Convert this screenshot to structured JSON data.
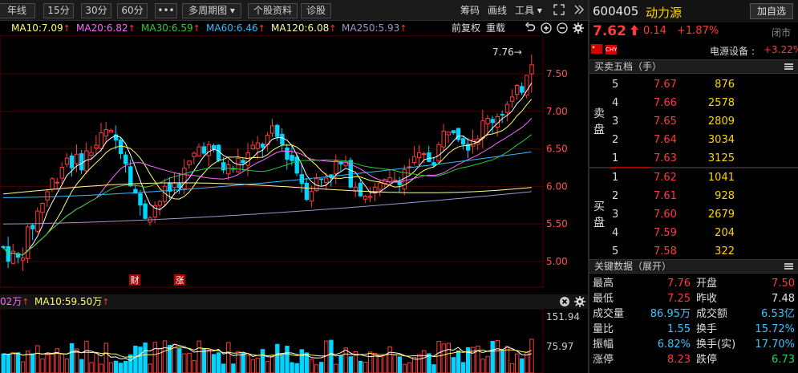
{
  "toolbar": {
    "period_buttons": [
      "年线",
      "15分",
      "30分",
      "60分"
    ],
    "more_label": "•••",
    "multi_period_label": "多周期图 ▾",
    "stock_info_label": "个股资料",
    "diagnosis_label": "诊股",
    "chip_label": "筹码",
    "draw_label": "画线",
    "tools_label": "工具 ▾",
    "expand_icon": "expand-icon",
    "collapse_icon": "double-chevron-right-icon"
  },
  "ma_legend": [
    {
      "label": "MA10:7.09",
      "color": "#ffff66"
    },
    {
      "label": "MA20:6.82",
      "color": "#ff66ff"
    },
    {
      "label": "MA30:6.59",
      "color": "#33cc33"
    },
    {
      "label": "MA60:6.46",
      "color": "#33bbff"
    },
    {
      "label": "MA120:6.08",
      "color": "#ffff99"
    },
    {
      "label": "MA250:5.93",
      "color": "#9999cc"
    }
  ],
  "adjust": {
    "forward_label": "前复权",
    "reload_label": "重载"
  },
  "price_axis": [
    "7.50",
    "7.00",
    "6.50",
    "6.00",
    "5.50",
    "5.00"
  ],
  "high_marker": "7.76→",
  "chart_markers": [
    "财",
    "涨"
  ],
  "volume": {
    "label_left": "02万",
    "ma_label": "MA10:59.50万",
    "axis": [
      "151.94",
      "75.97"
    ]
  },
  "stock": {
    "code": "600405",
    "name": "动力源",
    "add_label": "加自选",
    "price": "7.62",
    "change": "0.14",
    "change_pct": "+1.87%",
    "status": "闭市",
    "sector_label": "电源设备 :",
    "sector_pct": "+3.22%",
    "flag_text": "CHY"
  },
  "order_book": {
    "title": "买卖五档（手）",
    "sell_label": [
      "卖",
      "盘"
    ],
    "buy_label": [
      "买",
      "盘"
    ],
    "asks": [
      {
        "level": "5",
        "price": "7.67",
        "vol": "876"
      },
      {
        "level": "4",
        "price": "7.66",
        "vol": "2578"
      },
      {
        "level": "3",
        "price": "7.65",
        "vol": "2809"
      },
      {
        "level": "2",
        "price": "7.64",
        "vol": "3034"
      },
      {
        "level": "1",
        "price": "7.63",
        "vol": "3125"
      }
    ],
    "bids": [
      {
        "level": "1",
        "price": "7.62",
        "vol": "1041"
      },
      {
        "level": "2",
        "price": "7.61",
        "vol": "928"
      },
      {
        "level": "3",
        "price": "7.60",
        "vol": "2679"
      },
      {
        "level": "4",
        "price": "7.59",
        "vol": "204"
      },
      {
        "level": "5",
        "price": "7.58",
        "vol": "322"
      }
    ]
  },
  "key_data": {
    "title": "关键数据（展开）",
    "rows": [
      {
        "l1": "最高",
        "v1": "7.76",
        "c1": "red",
        "l2": "开盘",
        "v2": "7.50",
        "c2": "red"
      },
      {
        "l1": "最低",
        "v1": "7.25",
        "c1": "red",
        "l2": "昨收",
        "v2": "7.48",
        "c2": "white"
      },
      {
        "l1": "成交量",
        "v1": "86.95万",
        "c1": "cyan",
        "l2": "成交额",
        "v2": "6.53亿",
        "c2": "cyan"
      },
      {
        "l1": "量比",
        "v1": "1.55",
        "c1": "cyan",
        "l2": "换手",
        "v2": "15.72%",
        "c2": "cyan"
      },
      {
        "l1": "振幅",
        "v1": "6.82%",
        "c1": "cyan",
        "l2": "换手(实)",
        "v2": "17.70%",
        "c2": "cyan"
      },
      {
        "l1": "涨停",
        "v1": "8.23",
        "c1": "red",
        "l2": "跌停",
        "v2": "6.73",
        "c2": "green"
      }
    ]
  },
  "colors": {
    "up": "#ff3b3b",
    "down": "#00d5ff",
    "ma5": "#ffffff",
    "ma10": "#ffff66",
    "ma20": "#ff66ff",
    "ma30": "#33cc33",
    "ma60": "#33bbff",
    "ma120": "#ffff99",
    "ma250": "#9999cc"
  }
}
